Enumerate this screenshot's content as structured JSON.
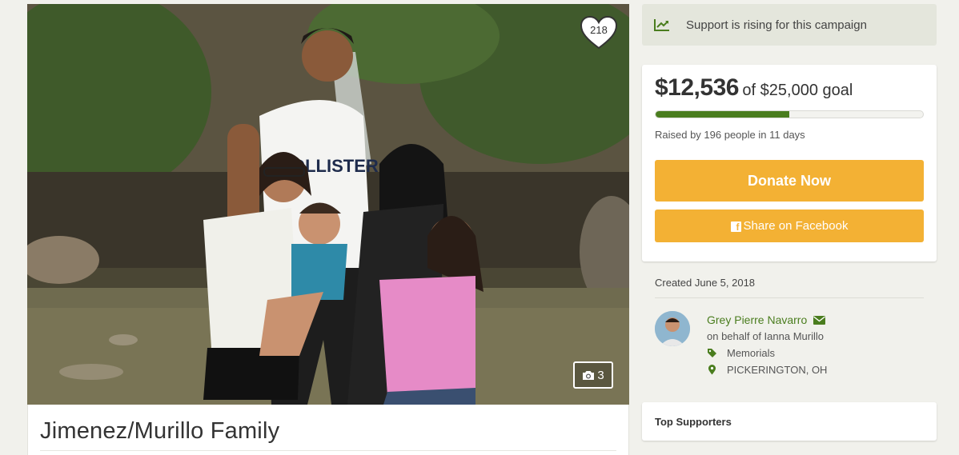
{
  "campaign": {
    "title": "Jimenez/Murillo Family",
    "likes": "218",
    "photo_count": "3",
    "rising_text": "Support is rising for this campaign",
    "raised_amount": "$12,536",
    "goal_text": "of $25,000 goal",
    "progress_fraction": 0.5,
    "raised_by_text": "Raised by 196 people in 11 days",
    "donate_label": "Donate Now",
    "share_label": "Share on Facebook",
    "created_text": "Created June 5, 2018",
    "organizer_name": "Grey Pierre Navarro",
    "behalf_text": "on behalf of Ianna Murillo",
    "category": "Memorials",
    "location": "PICKERINGTON, OH",
    "top_supporters_label": "Top Supporters"
  },
  "colors": {
    "accent_green": "#4a7d1e",
    "button_orange": "#f3b134",
    "page_bg": "#f1f1ec"
  },
  "icons": [
    "heart-icon",
    "camera-icon",
    "trend-up-icon",
    "facebook-icon",
    "envelope-icon",
    "tag-icon",
    "map-marker-icon"
  ]
}
